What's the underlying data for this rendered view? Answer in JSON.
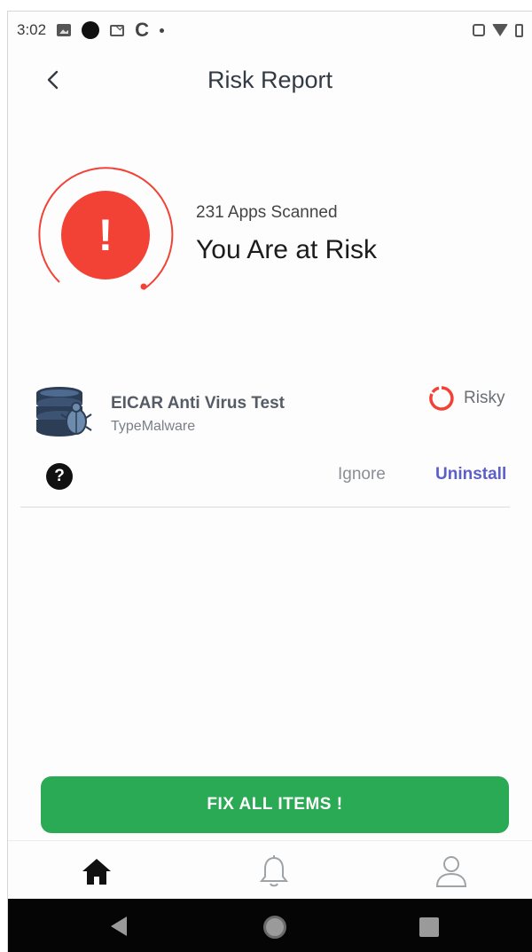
{
  "status_bar": {
    "time": "3:02",
    "icons_left": [
      "photo-icon",
      "record-dot-icon",
      "mail-icon",
      "c-icon",
      "dot-icon"
    ],
    "icons_right": [
      "vibrate-icon",
      "wifi-icon",
      "battery-icon"
    ]
  },
  "header": {
    "title": "Risk Report",
    "back_icon": "chevron-left-icon"
  },
  "summary": {
    "apps_scanned": "231 Apps Scanned",
    "status": "You Are at Risk",
    "alert_icon": "exclamation-icon",
    "alert_symbol": "!"
  },
  "app_item": {
    "name": "EICAR Anti Virus Test",
    "type": "TypeMalware",
    "icon": "malware-database-icon",
    "risk_label": "Risky",
    "risk_icon": "risk-ring-icon",
    "help_symbol": "?",
    "ignore_label": "Ignore",
    "uninstall_label": "Uninstall"
  },
  "actions": {
    "fix_all_label": "FIX ALL ITEMS !"
  },
  "bottom_nav": {
    "items": [
      {
        "name": "home",
        "icon": "home-icon",
        "active": true
      },
      {
        "name": "alerts",
        "icon": "bell-icon",
        "active": false
      },
      {
        "name": "profile",
        "icon": "user-icon",
        "active": false
      }
    ]
  },
  "colors": {
    "danger": "#f24236",
    "success": "#2aaa54",
    "accent": "#5b5fc7"
  }
}
